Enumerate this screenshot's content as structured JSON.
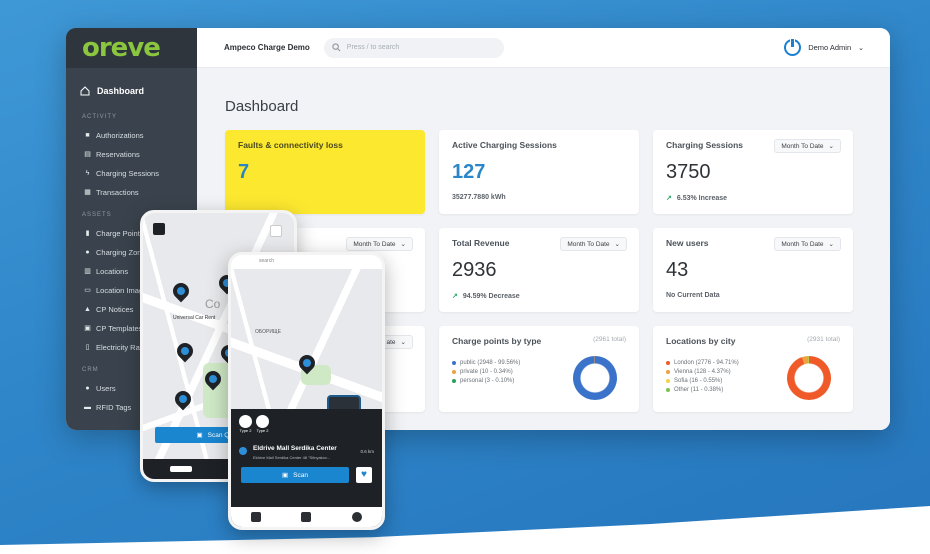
{
  "app": {
    "logo": "oreve",
    "org_name": "Ampeco Charge Demo",
    "search_placeholder": "Press / to search",
    "user_name": "Demo Admin"
  },
  "sidebar": {
    "dashboard_label": "Dashboard",
    "activity_label": "ACTIVITY",
    "activity_items": [
      "Authorizations",
      "Reservations",
      "Charging Sessions",
      "Transactions"
    ],
    "assets_label": "ASSETS",
    "assets_items": [
      "Charge Points",
      "Charging Zones",
      "Locations",
      "Location Images",
      "CP Notices",
      "CP Templates",
      "Electricity Rates"
    ],
    "crm_label": "CRM",
    "crm_items": [
      "Users",
      "RFID Tags"
    ]
  },
  "main": {
    "title": "Dashboard",
    "cards": {
      "faults": {
        "title": "Faults & connectivity loss",
        "value": "7"
      },
      "active_sessions": {
        "title": "Active Charging Sessions",
        "value": "127",
        "sub": "35277.7880 kWh"
      },
      "charging_sessions": {
        "title": "Charging Sessions",
        "value": "3750",
        "sub": "6.53% Increase",
        "period": "Month To Date"
      },
      "left_mid": {
        "period": "Month To Date"
      },
      "total_revenue": {
        "title": "Total Revenue",
        "value": "2936",
        "sub": "94.59% Decrease",
        "period": "Month To Date"
      },
      "new_users": {
        "title": "New users",
        "value": "43",
        "sub": "No Current Data",
        "period": "Month To Date"
      },
      "left_bottom": {
        "period": "ate"
      },
      "cp_by_type": {
        "title": "Charge points by type",
        "total": "(2961 total)",
        "legend": [
          "public (2948 - 99.56%)",
          "private (10 - 0.34%)",
          "personal (3 - 0.10%)"
        ],
        "colors": [
          "#3a73c9",
          "#f0a040",
          "#2e9e5b"
        ]
      },
      "loc_by_city": {
        "title": "Locations by city",
        "total": "(2931 total)",
        "legend": [
          "London (2776 - 94.71%)",
          "Vienna (128 - 4.37%)",
          "Sofia (16 - 0.55%)",
          "Other (11 - 0.38%)"
        ],
        "colors": [
          "#f05a28",
          "#f0a040",
          "#f7d144",
          "#7fc24b"
        ]
      }
    }
  },
  "phone_back": {
    "map_label_1": "Universal Car Rent",
    "map_label_2": "Co",
    "scan_button": "Scan QR C"
  },
  "phone_front": {
    "search_label": "search",
    "map_label": "ОБОРИЩЕ",
    "station_name": "Eldrive Mall Serdika Center",
    "station_address": "Eldrive Mall Serdika Center 48 \"Sitnyakov...",
    "distance": "0.6 km",
    "connector_1": "Type 2",
    "connector_2": "Type 2",
    "scan_button": "Scan"
  }
}
